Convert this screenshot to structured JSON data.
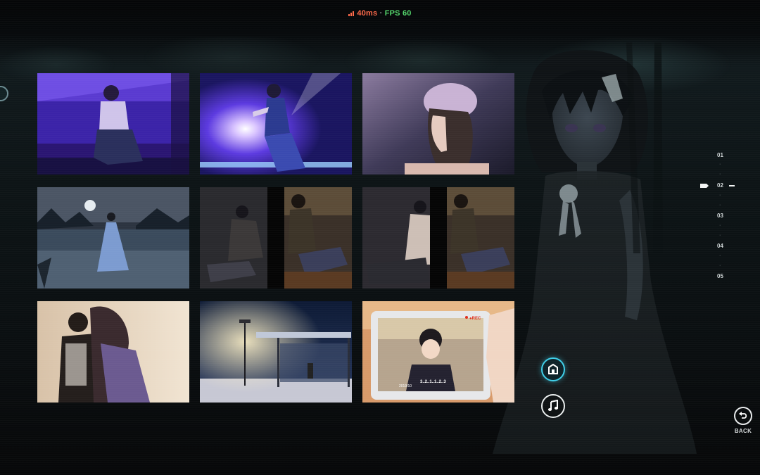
{
  "hud": {
    "ping": "40ms",
    "separator": "·",
    "fps": "FPS 60"
  },
  "colors": {
    "ping": "#ff6a4a",
    "fps": "#54d66c",
    "accent": "#3fd0ea"
  },
  "gallery": {
    "thumbnails": [
      {
        "scene": "girl-sitting-purple-room"
      },
      {
        "scene": "girl-idol-stage-lights"
      },
      {
        "scene": "girl-beret-profile"
      },
      {
        "scene": "girl-in-lake-night"
      },
      {
        "scene": "split-girl-boy-sitting-dark"
      },
      {
        "scene": "split-girl-boy-sitting-light"
      },
      {
        "scene": "couple-hug"
      },
      {
        "scene": "snowy-bus-stop-lamp"
      },
      {
        "scene": "phone-recording-boy"
      }
    ]
  },
  "pager": {
    "pages": [
      "01",
      "02",
      "03",
      "04",
      "05"
    ],
    "current": "02"
  },
  "buttons": {
    "gallery_icon": "gallery-icon",
    "music_icon": "music-note-icon",
    "back_icon": "back-arrow-icon",
    "back_label": "BACK"
  },
  "phone_overlay": {
    "rec_label": "●REC",
    "counter": "3..2..1..1..2..3",
    "timestamp": "2019/10"
  }
}
